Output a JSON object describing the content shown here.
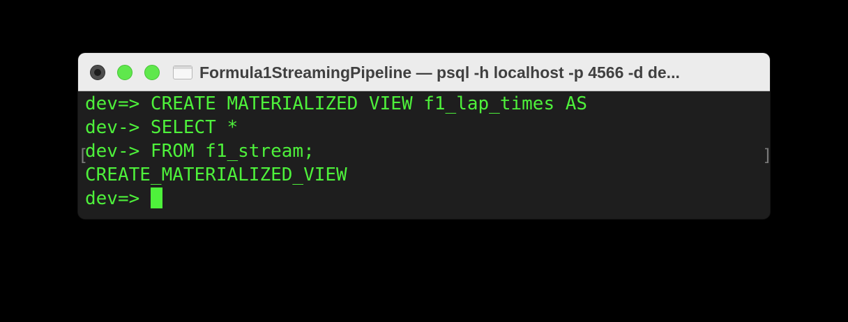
{
  "window": {
    "title": "Formula1StreamingPipeline — psql -h localhost -p 4566 -d de..."
  },
  "terminal": {
    "lines": [
      "dev=> CREATE MATERIALIZED VIEW f1_lap_times AS",
      "dev-> SELECT *",
      "dev-> FROM f1_stream;",
      "CREATE_MATERIALIZED_VIEW",
      "dev=> "
    ],
    "mark_open": "[",
    "mark_close": "]"
  },
  "colors": {
    "terminal_text": "#4ef13b",
    "terminal_background": "#1e1e1e",
    "titlebar_background": "#ececec",
    "traffic_light_green": "#5fe84c",
    "traffic_light_close": "#4d4d4d"
  },
  "icons": {
    "close": "close-icon",
    "minimize": "minimize-icon",
    "zoom": "zoom-icon",
    "proxy": "document-icon"
  }
}
